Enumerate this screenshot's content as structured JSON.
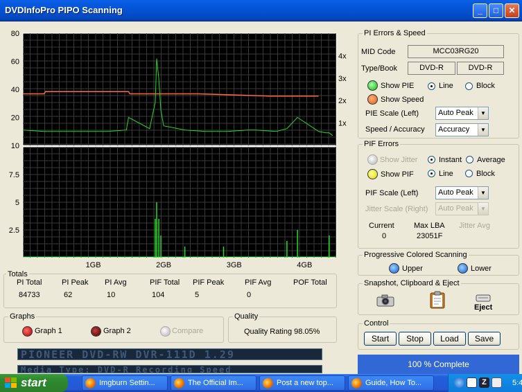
{
  "window": {
    "title": "DVDInfoPro PIPO Scanning"
  },
  "chart_data": [
    {
      "type": "line",
      "title": "",
      "y_left_ticks": [
        "80",
        "60",
        "40",
        "20",
        "10"
      ],
      "y_left_range": [
        0,
        80
      ],
      "y_right_ticks": [
        "4x",
        "3x",
        "2x",
        "1x"
      ],
      "y_right_range": [
        0,
        5
      ],
      "x_ticks": [
        "1GB",
        "2GB",
        "3GB",
        "4GB"
      ],
      "x_range_gb": [
        0,
        4.45
      ],
      "grid": true,
      "series": [
        {
          "name": "PIE",
          "color": "#22dd22",
          "x": [
            0,
            0.3,
            0.6,
            0.9,
            1.2,
            1.47,
            1.5,
            1.8,
            1.88,
            1.9,
            1.93,
            1.96,
            2.0,
            2.3,
            2.6,
            2.9,
            3.2,
            3.3,
            3.6,
            3.75,
            3.9,
            4.2,
            4.3,
            4.35,
            4.4
          ],
          "y": [
            11,
            10,
            10,
            10,
            10,
            11,
            20,
            12,
            31,
            62,
            48,
            25,
            14,
            11,
            10,
            10,
            11,
            11,
            10,
            12,
            20,
            10,
            9,
            9,
            7
          ]
        },
        {
          "name": "Speed",
          "color": "#ff6a3c",
          "x": [
            0,
            0.3,
            0.32,
            1.0,
            1.5,
            1.52,
            2.5,
            3.5,
            4.2
          ],
          "y": [
            2.3,
            2.3,
            2.4,
            2.4,
            2.4,
            2.3,
            2.3,
            2.2,
            2.2
          ]
        }
      ]
    },
    {
      "type": "line",
      "y_left_ticks": [
        "7.5",
        "5",
        "2.5"
      ],
      "y_left_range": [
        0,
        10
      ],
      "x_ticks": [
        "1GB",
        "2GB",
        "3GB",
        "4GB"
      ],
      "x_range_gb": [
        0,
        4.45
      ],
      "grid": true,
      "series": [
        {
          "name": "PIF",
          "color": "#22dd22",
          "x": [
            1.88,
            1.9,
            1.93,
            1.96,
            2.3,
            2.85,
            3.75,
            3.9,
            4.35
          ],
          "y": [
            3.5,
            5.0,
            3.5,
            2.0,
            1.0,
            1.0,
            1.5,
            2.5,
            2.0
          ]
        }
      ]
    }
  ],
  "totals": {
    "label": "Totals",
    "headers": [
      "PI Total",
      "PI Peak",
      "PI Avg",
      "PIF Total",
      "PIF Peak",
      "PIF Avg",
      "POF Total"
    ],
    "values": [
      "84733",
      "62",
      "10",
      "104",
      "5",
      "0",
      ""
    ]
  },
  "graphs": {
    "label": "Graphs",
    "graph1": "Graph 1",
    "graph2": "Graph 2",
    "compare": "Compare"
  },
  "quality": {
    "label": "Quality",
    "text": "Quality Rating 98.05%"
  },
  "lcd": {
    "line1": "PIONEER DVD-RW  DVR-111D 1.29",
    "line2": "Media Type: DVD-R  Recording Speed"
  },
  "pi": {
    "label": "PI Errors & Speed",
    "mid_label": "MID Code",
    "mid_value": "MCC03RG20",
    "type_label": "Type/Book",
    "type_value": "DVD-R",
    "book_value": "DVD-R",
    "show_pie": "Show PIE",
    "show_speed": "Show Speed",
    "line": "Line",
    "block": "Block",
    "pie_scale_label": "PIE Scale (Left)",
    "pie_scale_value": "Auto Peak",
    "speed_label": "Speed / Accuracy",
    "speed_value": "Accuracy"
  },
  "pif": {
    "label": "PIF Errors",
    "show_jitter": "Show Jitter",
    "instant": "Instant",
    "average": "Average",
    "show_pif": "Show PIF",
    "line": "Line",
    "block": "Block",
    "pif_scale_label": "PIF Scale (Left)",
    "pif_scale_value": "Auto Peak",
    "jitter_scale_label": "Jitter Scale (Right)",
    "jitter_scale_value": "Auto Peak",
    "current_label": "Current",
    "current_value": "0",
    "maxlba_label": "Max LBA",
    "maxlba_value": "23051F",
    "jitter_avg_label": "Jitter Avg"
  },
  "progressive": {
    "label": "Progressive Colored Scanning",
    "upper": "Upper",
    "lower": "Lower"
  },
  "snapshot": {
    "label": "Snapshot,  Clipboard  & Eject",
    "eject": "Eject"
  },
  "control": {
    "label": "Control",
    "start": "Start",
    "stop": "Stop",
    "load": "Load",
    "save": "Save"
  },
  "progress": {
    "text": "100 % Complete",
    "value": 1.0
  },
  "taskbar": {
    "start": "start",
    "tasks": [
      "Imgburn Settin...",
      "The Official Im...",
      "Post a new top...",
      "Guide, How To..."
    ],
    "clock": "5:4"
  }
}
